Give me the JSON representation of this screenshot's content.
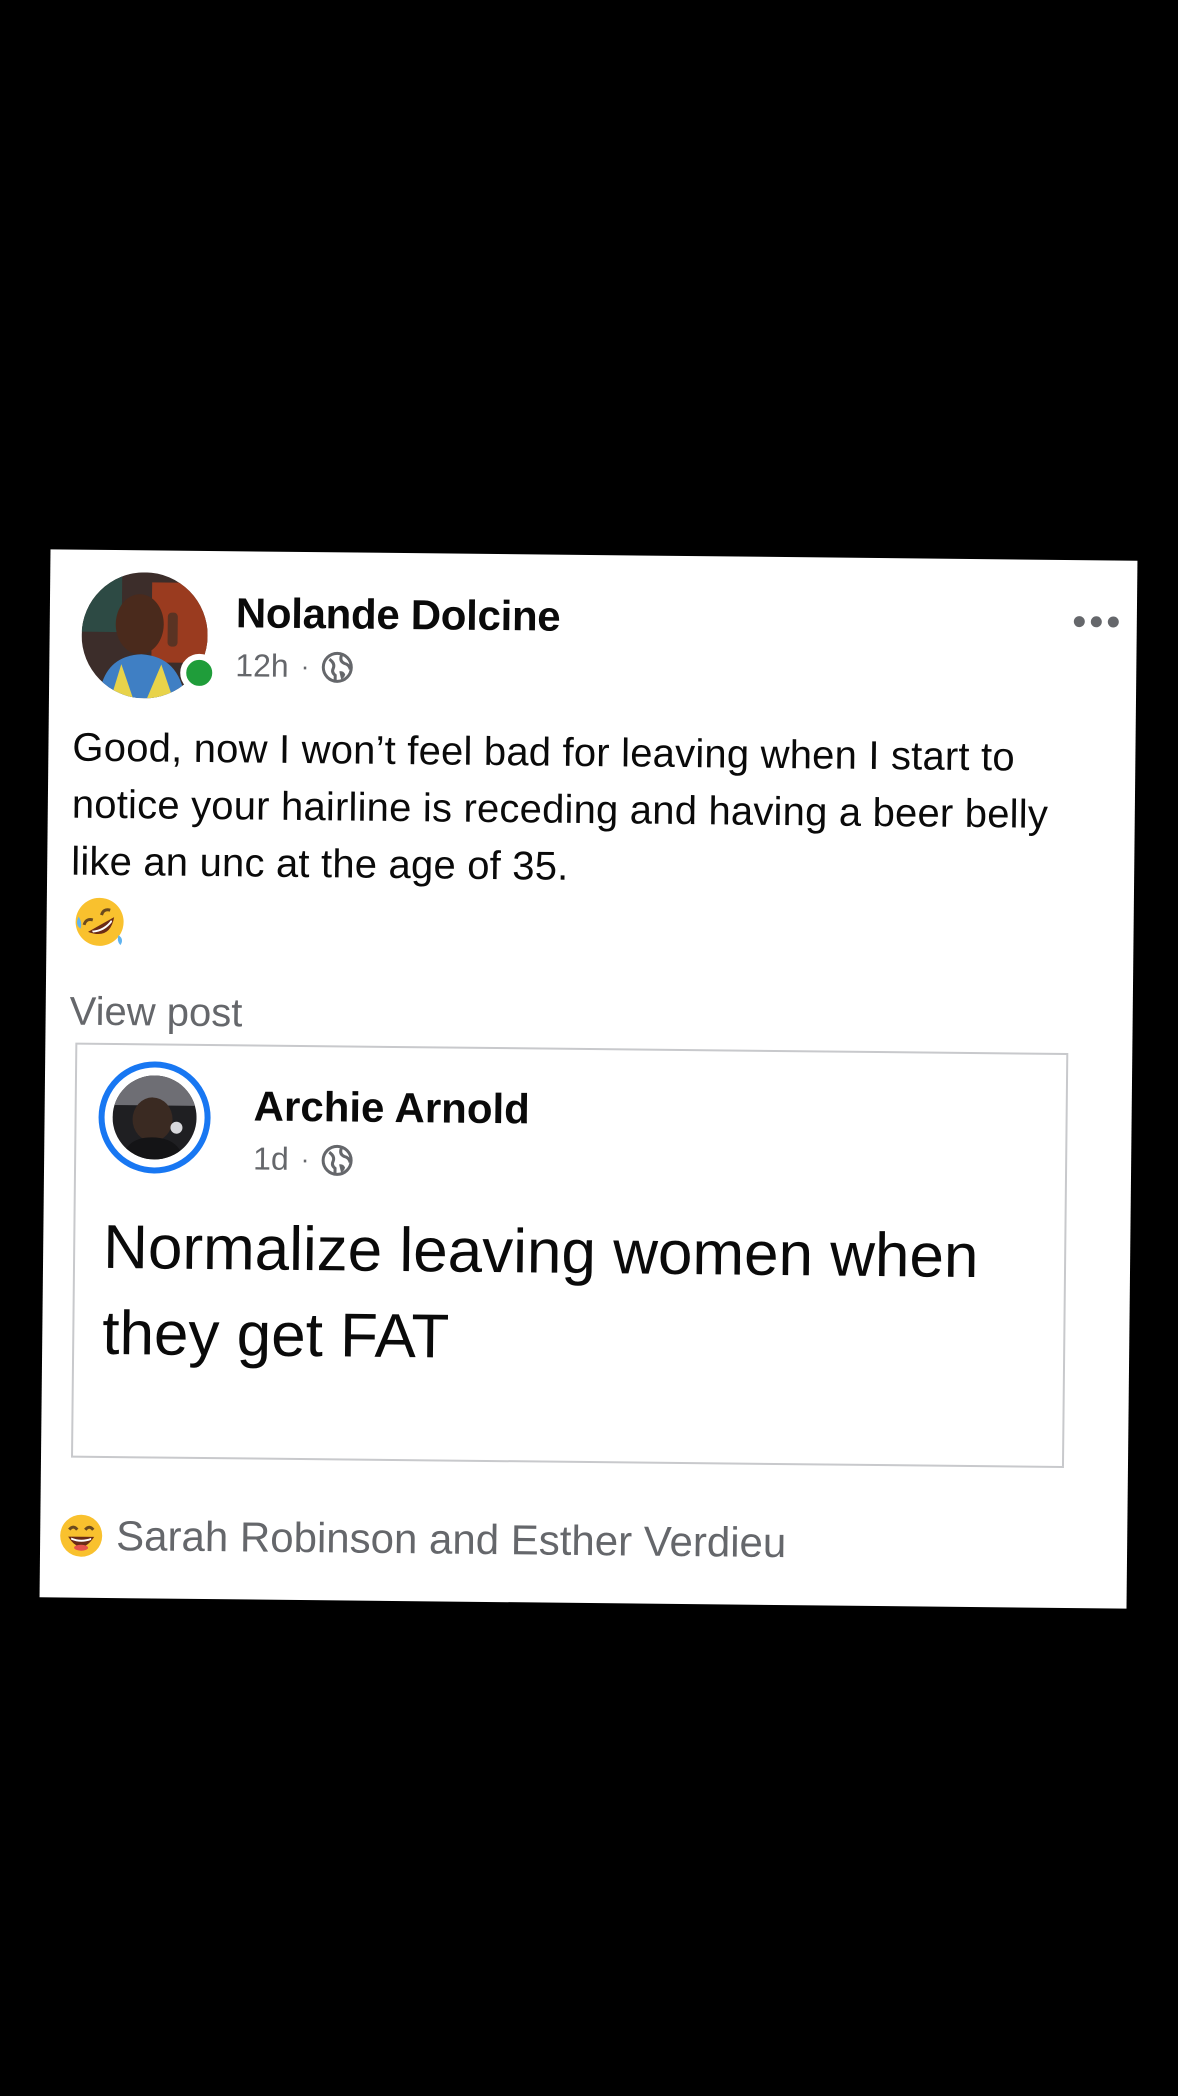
{
  "post": {
    "author": "Nolande Dolcine",
    "time": "12h",
    "separator": "·",
    "audience_icon": "globe-icon",
    "online": true,
    "text": "Good, now I won’t feel bad for leaving when I start to notice your hairline is receding and having a beer belly like an unc at the age of 35.",
    "emoji": "rolling-on-floor-laughing",
    "view_post_label": "View post"
  },
  "shared_post": {
    "author": "Archie Arnold",
    "time": "1d",
    "separator": "·",
    "audience_icon": "globe-icon",
    "text": "Normalize leaving women when they get FAT"
  },
  "reactions": {
    "emoji": "grinning-face",
    "names": "Sarah Robinson and Esther Verdieu"
  },
  "colors": {
    "online": "#1f9d3a",
    "story_ring": "#1877f2",
    "secondary_text": "#65676b",
    "primary_text": "#0a0a0a",
    "background": "#000000",
    "card": "#ffffff"
  }
}
